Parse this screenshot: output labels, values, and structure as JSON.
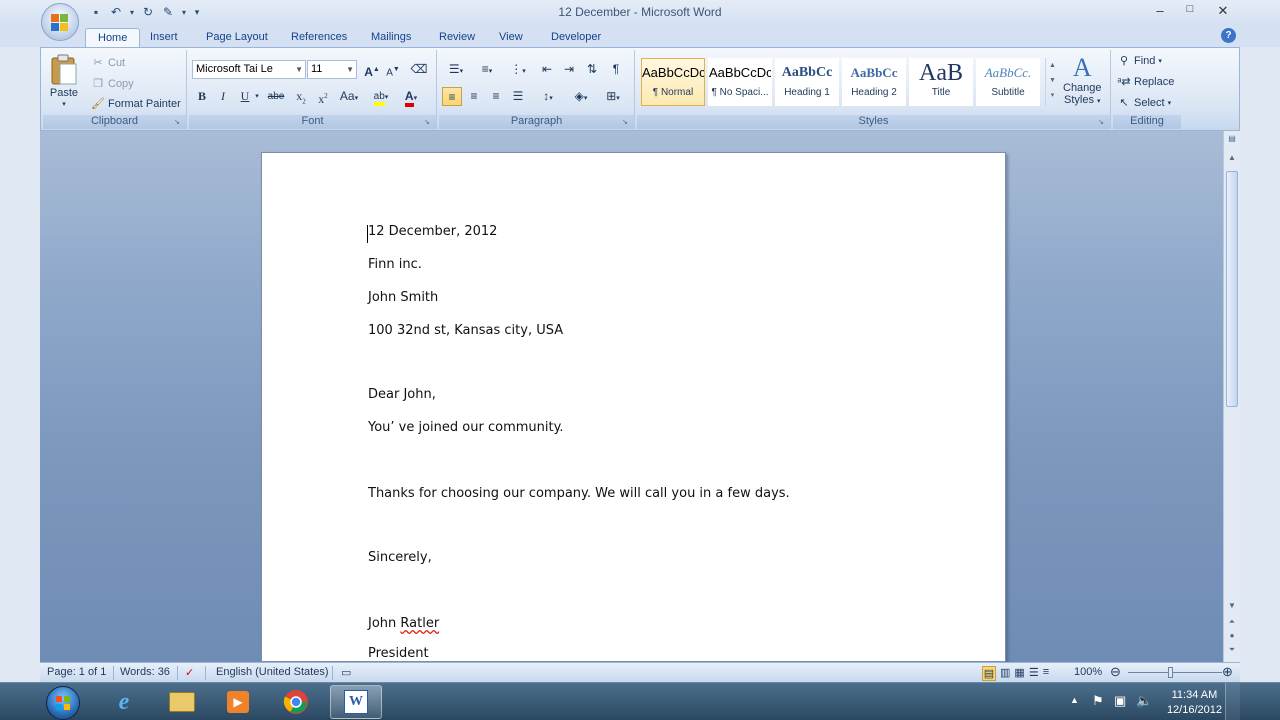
{
  "window": {
    "title": "12 December - Microsoft Word",
    "minimize": "–",
    "maximize": "□",
    "close": "✕"
  },
  "quick_access": {
    "icons": [
      "save-icon",
      "undo-icon",
      "redo-icon",
      "customize-icon"
    ]
  },
  "tabs": [
    "Home",
    "Insert",
    "Page Layout",
    "References",
    "Mailings",
    "Review",
    "View",
    "Developer"
  ],
  "active_tab": "Home",
  "ribbon": {
    "clipboard": {
      "label": "Clipboard",
      "paste": "Paste",
      "cut": "Cut",
      "copy": "Copy",
      "format_painter": "Format Painter"
    },
    "font": {
      "label": "Font",
      "font_name": "Microsoft Tai Le",
      "font_size": "11",
      "grow": "A",
      "shrink": "A",
      "bold": "B",
      "italic": "I",
      "underline": "U",
      "strike": "abe",
      "subscript": "x",
      "superscript": "x",
      "change_case": "Aa",
      "highlight": "ab",
      "font_color": "A"
    },
    "paragraph": {
      "label": "Paragraph",
      "pilcrow": "¶"
    },
    "styles": {
      "label": "Styles",
      "items": [
        {
          "sample": "AaBbCcDc",
          "name": "¶ Normal"
        },
        {
          "sample": "AaBbCcDc",
          "name": "¶ No Spaci..."
        },
        {
          "sample": "AaBbCc",
          "name": "Heading 1"
        },
        {
          "sample": "AaBbCc",
          "name": "Heading 2"
        },
        {
          "sample": "AaB",
          "name": "Title"
        },
        {
          "sample": "AaBbCc.",
          "name": "Subtitle"
        }
      ],
      "change_styles_1": "Change",
      "change_styles_2": "Styles"
    },
    "editing": {
      "label": "Editing",
      "find": "Find",
      "replace": "Replace",
      "select": "Select"
    }
  },
  "document": {
    "lines": [
      "12 December, 2012",
      "Finn inc.",
      "John Smith",
      "100 32nd st, Kansas city, USA",
      "Dear John,",
      "You’   ve joined our community.",
      "Thanks for choosing our company. We will call you in a few days.",
      "Sincerely,",
      "John ",
      "Ratler",
      "President"
    ]
  },
  "status": {
    "page": "Page: 1 of 1",
    "words": "Words: 36",
    "language": "English (United States)",
    "zoom": "100%"
  },
  "taskbar": {
    "apps": [
      "start-button",
      "internet-explorer",
      "file-explorer",
      "media-player",
      "chrome",
      "microsoft-word"
    ],
    "time": "11:34 AM",
    "date": "12/16/2012"
  },
  "colors": {
    "ribbon_accent": "#15428b",
    "taskbar": "#2b4862",
    "doc_background": "#8ea8ca"
  }
}
